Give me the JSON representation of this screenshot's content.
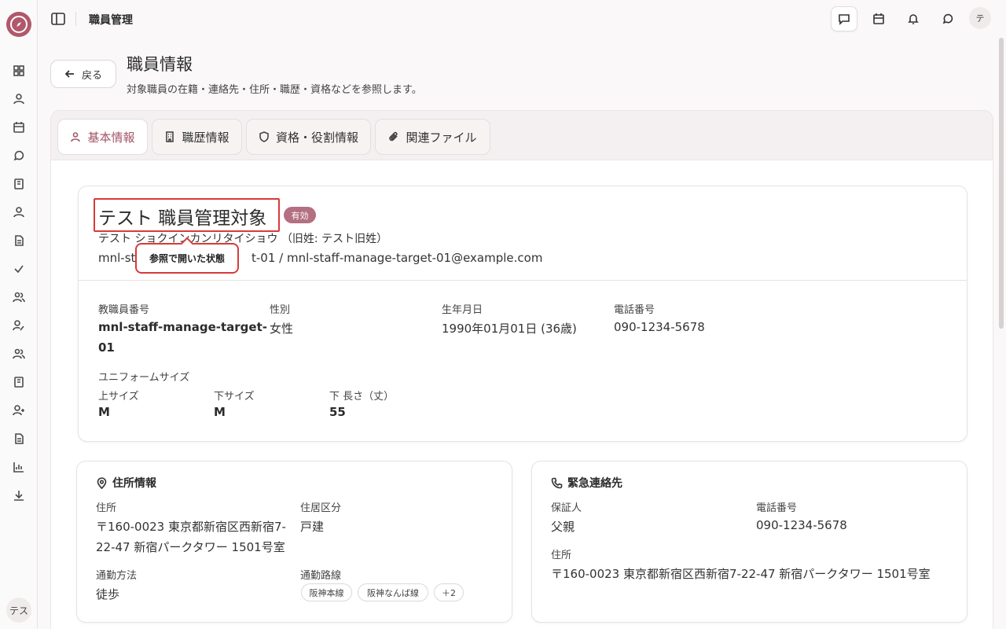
{
  "app": {
    "title": "職員管理",
    "user_initial": "テ",
    "sidebar_user": "テス",
    "brand_color": "#b0586c",
    "accent_color": "#a4566a"
  },
  "sidebar": {
    "icons": [
      "dashboard-icon",
      "user-icon",
      "calendar-icon",
      "chat-icon",
      "book-icon",
      "user-icon",
      "document-icon",
      "check-icon",
      "users-icon",
      "user-edit-icon",
      "users-icon",
      "book-icon",
      "user-plus-icon",
      "document-icon",
      "chart-icon",
      "download-icon"
    ]
  },
  "topbar": {
    "buttons": [
      "chat-square-icon",
      "calendar-icon",
      "bell-icon",
      "chat-bubble-icon"
    ]
  },
  "page": {
    "back_label": "戻る",
    "title": "職員情報",
    "subtitle": "対象職員の在籍・連絡先・住所・職歴・資格などを参照します。"
  },
  "tabs": [
    {
      "label": "基本情報",
      "icon": "user-icon",
      "active": true
    },
    {
      "label": "職歴情報",
      "icon": "building-icon",
      "active": false
    },
    {
      "label": "資格・役割情報",
      "icon": "shield-icon",
      "active": false
    },
    {
      "label": "関連ファイル",
      "icon": "paperclip-icon",
      "active": false
    }
  ],
  "profile": {
    "name": "テスト 職員管理対象",
    "status": "有効",
    "kana": "テスト ショクインカンリタイショウ （旧姓: テスト旧姓）",
    "id_prefix": "mnl-st",
    "id_suffix": "t-01 / mnl-staff-manage-target-01@example.com",
    "tooltip": "参照で開いた状態",
    "fields": {
      "staff_no_label": "教職員番号",
      "staff_no_line1": "mnl-staff-manage-target-",
      "staff_no_line2": "01",
      "gender_label": "性別",
      "gender": "女性",
      "birth_label": "生年月日",
      "birth": "1990年01月01日 (36歳)",
      "phone_label": "電話番号",
      "phone": "090-1234-5678"
    },
    "uniform": {
      "label": "ユニフォームサイズ",
      "top_label": "上サイズ",
      "top": "M",
      "bottom_label": "下サイズ",
      "bottom": "M",
      "length_label": "下 長さ（丈）",
      "length": "55"
    }
  },
  "address": {
    "title": "住所情報",
    "addr_label": "住所",
    "addr_line1": "〒160-0023 東京都新宿区西新宿7-",
    "addr_line2": "22-47 新宿パークタワー 1501号室",
    "residence_label": "住居区分",
    "residence": "戸建",
    "commute_label": "通勤方法",
    "commute": "徒歩",
    "route_label": "通勤路線",
    "routes": [
      "阪神本線",
      "阪神なんば線",
      "＋2"
    ]
  },
  "emergency": {
    "title": "緊急連絡先",
    "guardian_label": "保証人",
    "guardian": "父親",
    "phone_label": "電話番号",
    "phone": "090-1234-5678",
    "addr_label": "住所",
    "addr": "〒160-0023 東京都新宿区西新宿7-22-47 新宿パークタワー 1501号室"
  }
}
